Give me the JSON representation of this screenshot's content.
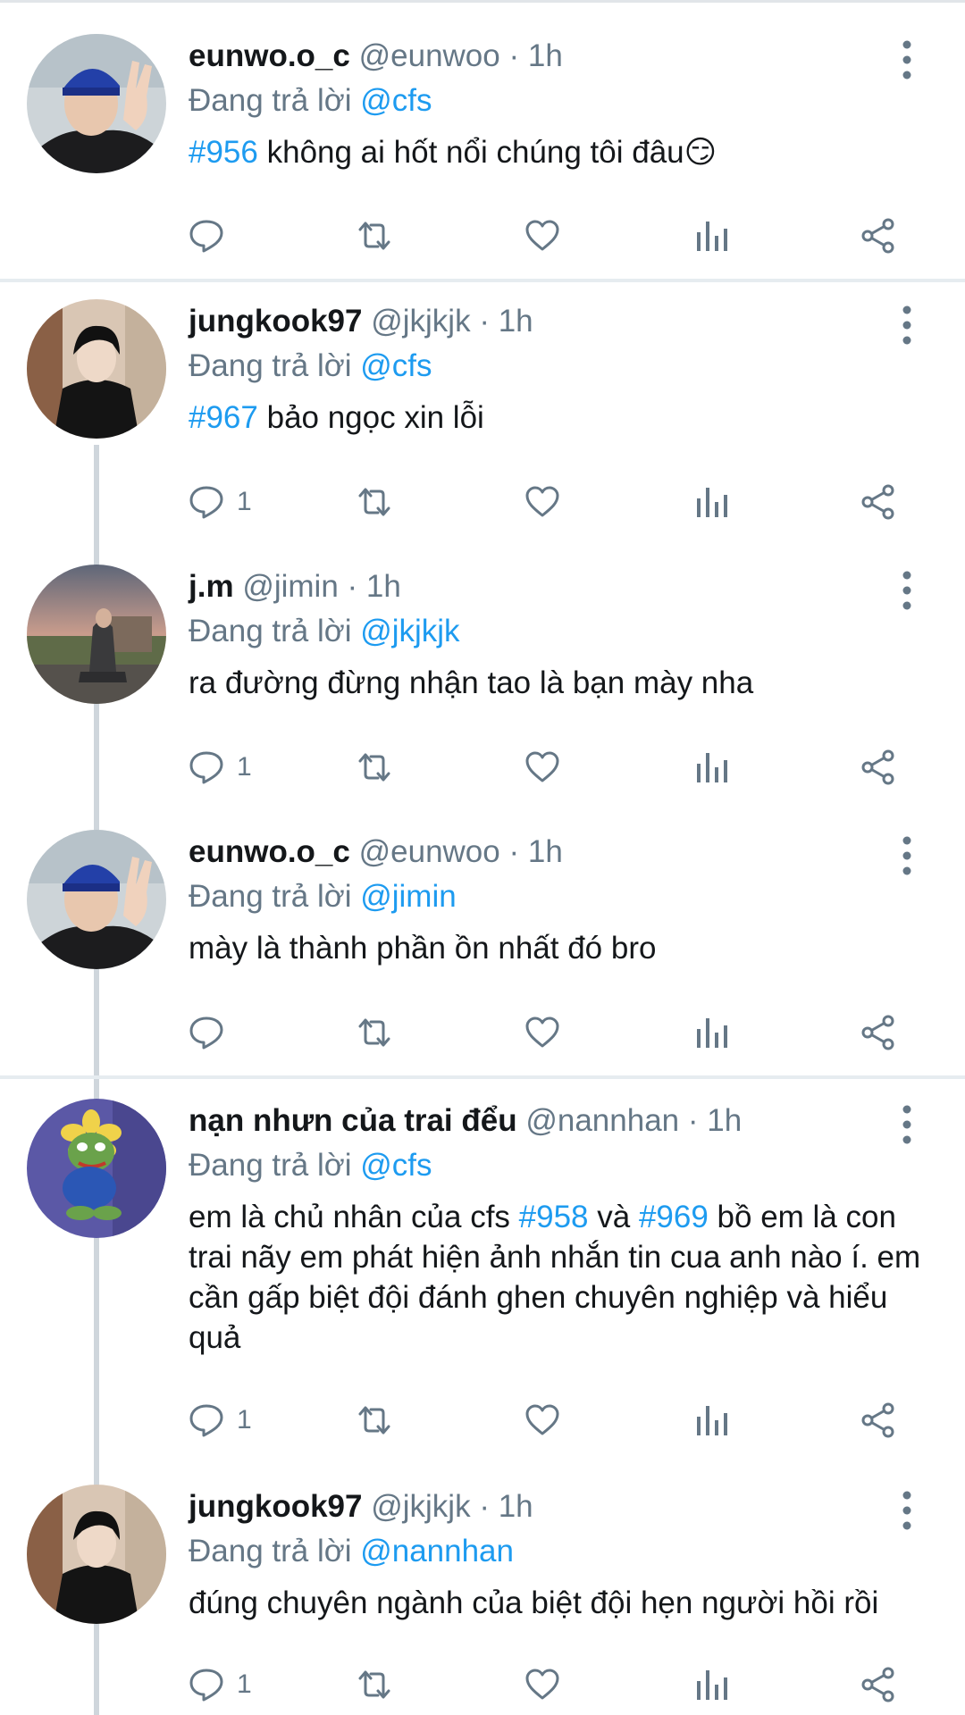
{
  "tweets": [
    {
      "name": "eunwo.o_c",
      "handle": "@eunwoo",
      "time": "· 1h",
      "reply_prefix": "Đang trả lời",
      "reply_to": "@cfs",
      "hashtag": "#956",
      "text": " không ai hốt nổi chúng tôi đâu",
      "emoji": "😏",
      "reply_count": "",
      "avatar": "avatar-peace-sign-cap"
    },
    {
      "name": "jungkook97",
      "handle": "@jkjkjk",
      "time": "· 1h",
      "reply_prefix": "Đang trả lời",
      "reply_to": "@cfs",
      "hashtag": "#967",
      "text": " bảo ngọc xin lỗi",
      "reply_count": "1",
      "avatar": "avatar-leather-jacket"
    },
    {
      "name": "j.m",
      "handle": "@jimin",
      "time": "· 1h",
      "reply_prefix": "Đang trả lời",
      "reply_to": "@jkjkjk",
      "text": "ra đường đừng nhận tao là bạn mày nha",
      "reply_count": "1",
      "avatar": "avatar-sunset-sitting"
    },
    {
      "name": "eunwo.o_c",
      "handle": "@eunwoo",
      "time": "· 1h",
      "reply_prefix": "Đang trả lời",
      "reply_to": "@jimin",
      "text": "mày là thành phần ồn nhất đó bro",
      "reply_count": "",
      "avatar": "avatar-peace-sign-cap"
    },
    {
      "name": "nạn nhưn của trai đểu",
      "handle": "@nannhan",
      "time": "· 1h",
      "reply_prefix": "Đang trả lời",
      "reply_to": "@cfs",
      "text_part1": "em là chủ nhân của cfs ",
      "hashtag1": "#958",
      "text_part2": " và ",
      "hashtag2": "#969",
      "text_part3": " bồ em là con trai nãy em phát hiện ảnh nhắn tin cua anh nào í. em cần gấp biệt đội đánh ghen chuyên nghiệp và hiểu quả",
      "reply_count": "1",
      "avatar": "avatar-frog-plush"
    },
    {
      "name": "jungkook97",
      "handle": "@jkjkjk",
      "time": "· 1h",
      "reply_prefix": "Đang trả lời",
      "reply_to": "@nannhan",
      "text": "đúng chuyên ngành của biệt đội hẹn người hồi rồi",
      "reply_count": "1",
      "avatar": "avatar-leather-jacket"
    }
  ],
  "colors": {
    "link": "#1d9bf0",
    "muted": "#657786",
    "text": "#14171a",
    "icon": "#657786",
    "thread_line": "#cfd6dc"
  }
}
